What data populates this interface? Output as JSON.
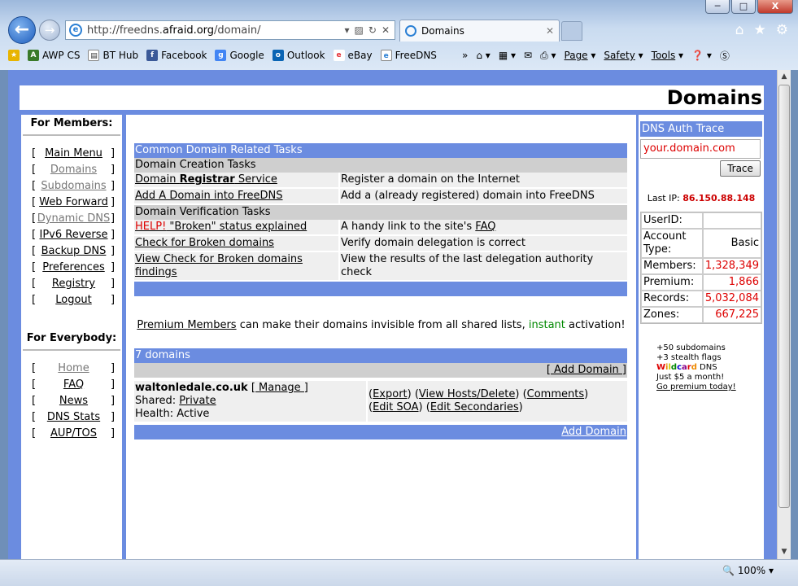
{
  "browser": {
    "window_buttons": {
      "minimize": "─",
      "maximize": "□",
      "close": "X"
    },
    "address": {
      "url_prefix": "http://freedns.",
      "url_host": "afraid.org",
      "url_suffix": "/domain/"
    },
    "tab_title": "Domains",
    "favorites": [
      "AWP CS",
      "BT Hub",
      "Facebook",
      "Google",
      "Outlook",
      "eBay",
      "FreeDNS"
    ],
    "toolbar": {
      "page": "Page",
      "safety": "Safety",
      "tools": "Tools"
    },
    "zoom": "100%"
  },
  "page": {
    "title": "Domains",
    "members": {
      "heading": "For Members:",
      "items": [
        {
          "label": "Main Menu",
          "grey": false
        },
        {
          "label": "Domains",
          "grey": true
        },
        {
          "label": "Subdomains",
          "grey": true
        },
        {
          "label": "Web Forward",
          "grey": false
        },
        {
          "label": "Dynamic DNS",
          "grey": true
        },
        {
          "label": "IPv6 Reverse",
          "grey": false
        },
        {
          "label": "Backup DNS",
          "grey": false
        },
        {
          "label": "Preferences",
          "grey": false
        },
        {
          "label": "Registry",
          "grey": false
        },
        {
          "label": "Logout",
          "grey": false
        }
      ]
    },
    "everybody": {
      "heading": "For Everybody:",
      "items": [
        {
          "label": "Home",
          "grey": true
        },
        {
          "label": "FAQ",
          "grey": false
        },
        {
          "label": "News",
          "grey": false
        },
        {
          "label": "DNS Stats",
          "grey": false
        },
        {
          "label": "AUP/TOS",
          "grey": false
        }
      ]
    },
    "tasks": {
      "header": "Common Domain Related Tasks",
      "creation_header": "Domain Creation Tasks",
      "registrar_a": "Domain ",
      "registrar_b": "Registrar",
      "registrar_c": " Service",
      "registrar_desc": "Register a domain on the Internet",
      "add_link": "Add A Domain into FreeDNS",
      "add_desc": "Add a (already registered) domain into FreeDNS",
      "verification_header": "Domain Verification Tasks",
      "help_red": "HELP!",
      "help_rest": " \"Broken\" status explained",
      "help_desc": "A handy link to the site's ",
      "help_faq": "FAQ",
      "check_link": "Check for Broken domains",
      "check_desc": "Verify domain delegation is correct",
      "view_link": "View Check for Broken domains findings",
      "view_desc": "View the results of the last delegation authority check"
    },
    "premium": {
      "link": "Premium Members",
      "text": " can make their domains invisible from all shared lists, ",
      "instant": "instant",
      "end": " activation!"
    },
    "domains": {
      "count_label": "7 domains",
      "add_top": "[ Add Domain ]",
      "name": "waltonledale.co.uk",
      "manage": "[ Manage ]",
      "shared_label": "Shared: ",
      "shared_value": "Private",
      "health": "Health: Active",
      "export": "Export",
      "view_hosts": "View Hosts/Delete",
      "comments": "Comments",
      "edit_soa": "Edit SOA",
      "edit_secondaries": "Edit Secondaries",
      "add_bottom": "Add Domain"
    },
    "auth": {
      "header": "DNS Auth Trace",
      "placeholder": "your.domain.com",
      "button": "Trace"
    },
    "last_ip": {
      "label": "Last IP: ",
      "value": "86.150.88.148"
    },
    "stats": [
      {
        "label": "UserID:",
        "value": "",
        "plain": true
      },
      {
        "label": "Account Type:",
        "value": "Basic",
        "plain": true
      },
      {
        "label": "Members:",
        "value": "1,328,349",
        "plain": false
      },
      {
        "label": "Premium:",
        "value": "1,866",
        "plain": false
      },
      {
        "label": "Records:",
        "value": "5,032,084",
        "plain": false
      },
      {
        "label": "Zones:",
        "value": "667,225",
        "plain": false
      }
    ],
    "promo": {
      "line1": "+50 subdomains",
      "line2": "+3 stealth flags",
      "wildcard": "Wildcard",
      "dns": " DNS",
      "line4": "Just $5 a month!",
      "line5": "Go premium today!"
    }
  }
}
